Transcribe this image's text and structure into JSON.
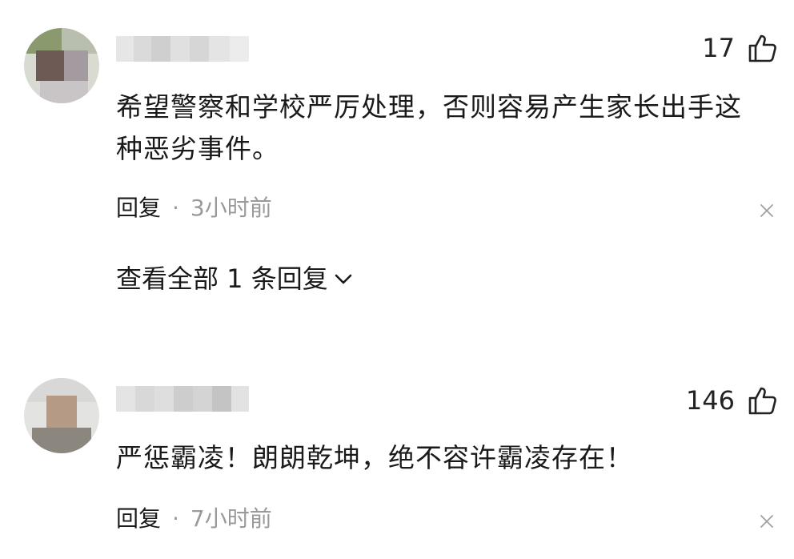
{
  "comments": [
    {
      "likes": "17",
      "text_lines": [
        "希望警察和学校严厉处理，否则容易产生家长出手这",
        "种恶劣事件。"
      ],
      "reply_label": "回复",
      "separator": "·",
      "time": "3小时前",
      "view_replies": "查看全部 1 条回复"
    },
    {
      "likes": "146",
      "text_lines": [
        "严惩霸凌！朗朗乾坤，绝不容许霸凌存在！"
      ],
      "reply_label": "回复",
      "separator": "·",
      "time": "7小时前"
    }
  ],
  "icons": {
    "like": "thumbs-up-icon",
    "close": "close-icon",
    "expand": "chevron-down-icon"
  },
  "colors": {
    "text": "#1a1a1a",
    "meta": "#9a9a9a",
    "background": "#ffffff"
  }
}
